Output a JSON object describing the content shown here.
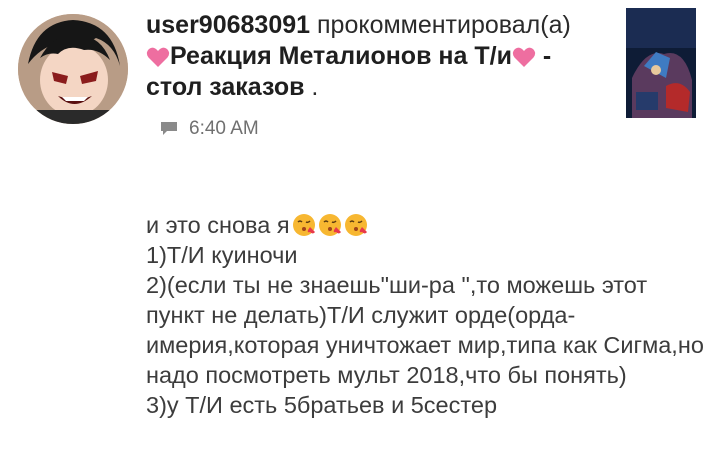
{
  "comment_header": {
    "username": "user90683091",
    "action": "прокомментировал(а)",
    "post_title": "Реакция Металионов на Т/и",
    "post_suffix": "- стол заказов",
    "period": "."
  },
  "meta": {
    "time": "6:40 AM",
    "icon": "chat-bubble-icon"
  },
  "comment": {
    "first_line": "и это снова я",
    "emoji": "kissing-heart-emoji",
    "body": "1)Т/И куиночи\n2)(если ты не знаешь\"ши-ра \",то можешь этот пункт не делать)Т/И служит орде(орда-имерия,которая уничтожает мир,типа как Сигма,но надо посмотреть мульт 2018,что бы понять)\n3)у Т/И есть 5братьев и 5сестер"
  },
  "colors": {
    "heart": "#ee6ea0",
    "text": "#3c3c3c",
    "meta": "#707070"
  }
}
